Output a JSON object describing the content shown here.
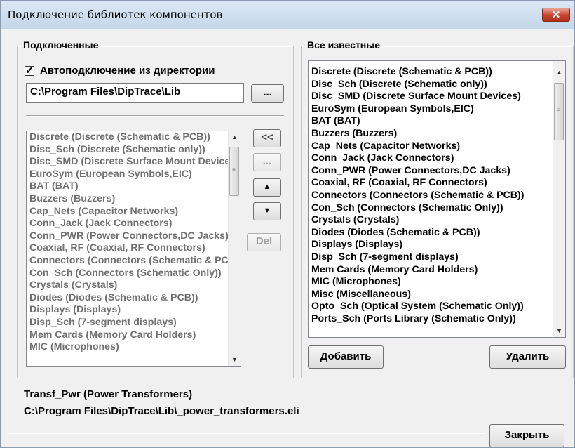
{
  "window": {
    "title": "Подключение библиотек компонентов",
    "close_icon": "✕"
  },
  "connected": {
    "legend": "Подключенные",
    "autoconnect_label": "Автоподключение из директории",
    "autoconnect_checked": true,
    "directory_value": "C:\\Program Files\\DipTrace\\Lib",
    "browse_label": "...",
    "items": [
      "Discrete (Discrete (Schematic & PCB))",
      "Disc_Sch (Discrete (Schematic only))",
      "Disc_SMD (Discrete Surface Mount Devices)",
      "EuroSym (European Symbols,EIC)",
      "BAT (BAT)",
      "Buzzers (Buzzers)",
      "Cap_Nets (Capacitor Networks)",
      "Conn_Jack (Jack Connectors)",
      "Conn_PWR (Power Connectors,DC Jacks)",
      "Coaxial, RF (Coaxial, RF Connectors)",
      "Connectors (Connectors (Schematic & PCB))",
      "Con_Sch (Connectors (Schematic Only))",
      "Crystals (Crystals)",
      "Diodes (Diodes (Schematic & PCB))",
      "Displays (Displays)",
      "Disp_Sch (7-segment displays)",
      "Mem Cards (Memory Card Holders)",
      "MIC (Microphones)"
    ]
  },
  "middle_buttons": {
    "add_left": "<<",
    "dots": "...",
    "up_icon": "▲",
    "down_icon": "▼",
    "del": "Del"
  },
  "all_known": {
    "legend": "Все известные",
    "items": [
      "Discrete (Discrete (Schematic & PCB))",
      "Disc_Sch (Discrete (Schematic only))",
      "Disc_SMD (Discrete Surface Mount Devices)",
      "EuroSym (European Symbols,EIC)",
      "BAT (BAT)",
      "Buzzers (Buzzers)",
      "Cap_Nets (Capacitor Networks)",
      "Conn_Jack (Jack Connectors)",
      "Conn_PWR (Power Connectors,DC Jacks)",
      "Coaxial, RF (Coaxial, RF Connectors)",
      "Connectors (Connectors (Schematic & PCB))",
      "Con_Sch (Connectors (Schematic Only))",
      "Crystals (Crystals)",
      "Diodes (Diodes (Schematic & PCB))",
      "Displays (Displays)",
      "Disp_Sch (7-segment displays)",
      "Mem Cards (Memory Card Holders)",
      "MIC (Microphones)",
      "Misc (Miscellaneous)",
      "Opto_Sch (Optical System (Schematic Only))",
      "Ports_Sch (Ports Library (Schematic Only))"
    ],
    "add_label": "Добавить",
    "remove_label": "Удалить"
  },
  "status": {
    "library_name": "Transf_Pwr (Power Transformers)",
    "library_path": "C:\\Program Files\\DipTrace\\Lib\\_power_transformers.eli"
  },
  "footer": {
    "close_label": "Закрыть"
  },
  "scroll_icons": {
    "up": "▲",
    "down": "▼",
    "grip": "≡"
  }
}
